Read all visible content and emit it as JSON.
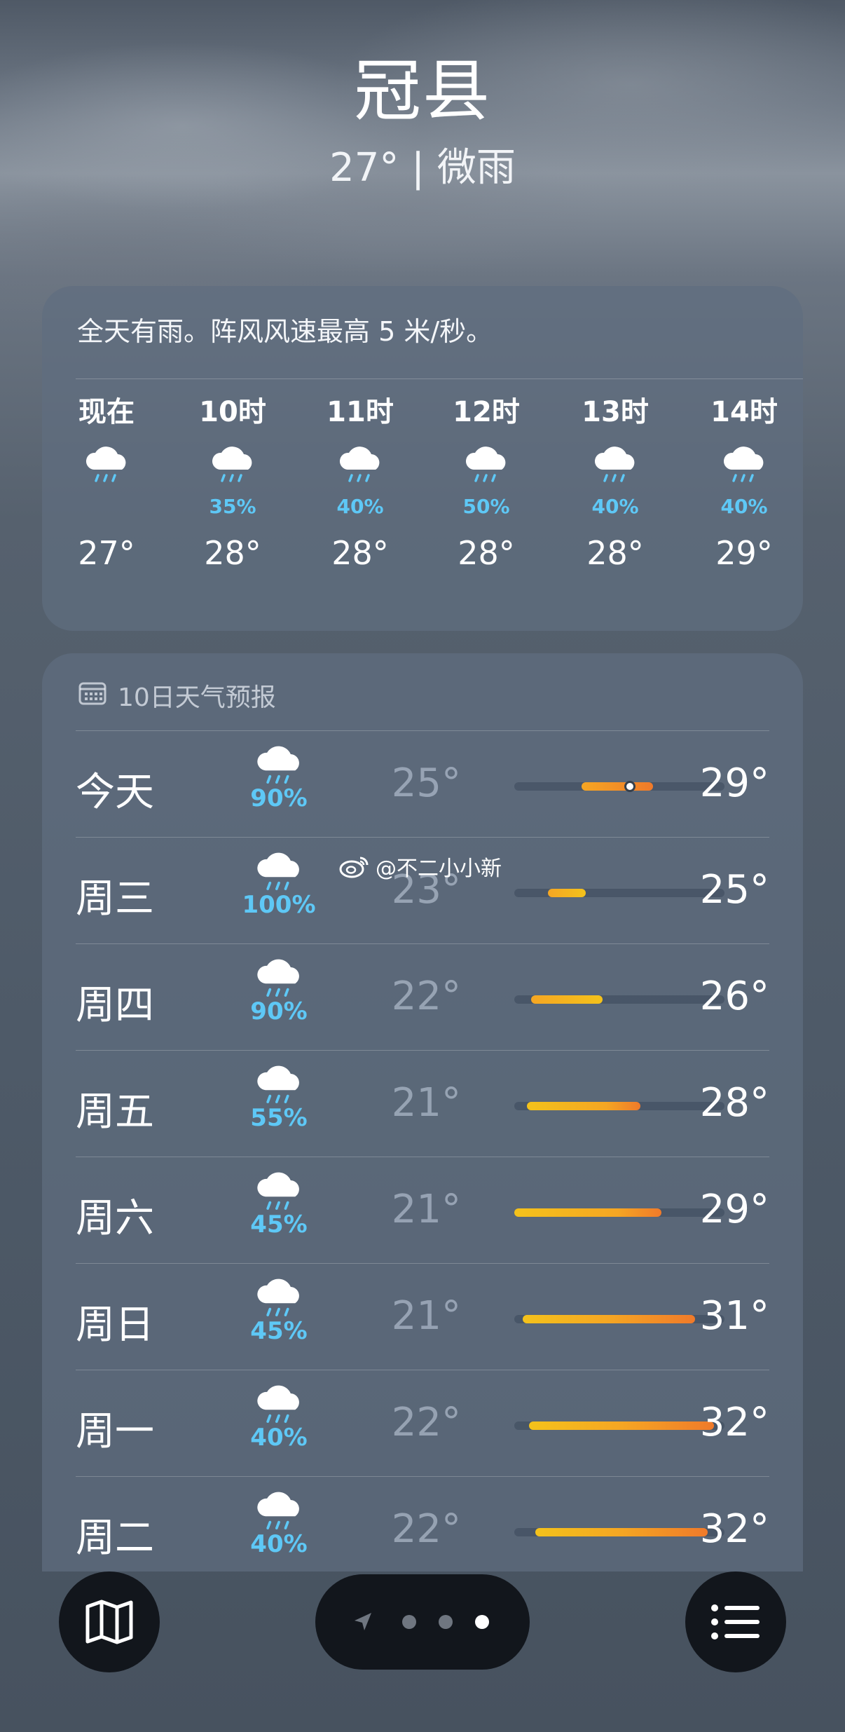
{
  "header": {
    "city": "冠县",
    "summary": "27° | 微雨"
  },
  "hourly_card": {
    "text": "全天有雨。阵风风速最高 5 米/秒。",
    "hours": [
      {
        "label": "现在",
        "icon": "rain-cloud-icon",
        "pop": "",
        "temp": "27°"
      },
      {
        "label": "10时",
        "icon": "rain-cloud-icon",
        "pop": "35%",
        "temp": "28°"
      },
      {
        "label": "11时",
        "icon": "rain-cloud-icon",
        "pop": "40%",
        "temp": "28°"
      },
      {
        "label": "12时",
        "icon": "rain-cloud-icon",
        "pop": "50%",
        "temp": "28°"
      },
      {
        "label": "13时",
        "icon": "rain-cloud-icon",
        "pop": "40%",
        "temp": "28°"
      },
      {
        "label": "14时",
        "icon": "rain-cloud-icon",
        "pop": "40%",
        "temp": "29°"
      }
    ]
  },
  "forecast": {
    "title": "10日天气预报",
    "title_icon": "calendar-icon",
    "range_fraction": [
      {
        "start": 0.32,
        "end": 0.66
      },
      {
        "start": 0.16,
        "end": 0.34
      },
      {
        "start": 0.08,
        "end": 0.42
      },
      {
        "start": 0.06,
        "end": 0.6
      },
      {
        "start": 0.0,
        "end": 0.7
      },
      {
        "start": 0.04,
        "end": 0.86
      },
      {
        "start": 0.07,
        "end": 0.95
      },
      {
        "start": 0.1,
        "end": 0.92
      }
    ],
    "days": [
      {
        "day": "今天",
        "pop": "90%",
        "low": "25°",
        "high": "29°",
        "current": true,
        "current_fraction": 0.55
      },
      {
        "day": "周三",
        "pop": "100%",
        "low": "23°",
        "high": "25°"
      },
      {
        "day": "周四",
        "pop": "90%",
        "low": "22°",
        "high": "26°"
      },
      {
        "day": "周五",
        "pop": "55%",
        "low": "21°",
        "high": "28°"
      },
      {
        "day": "周六",
        "pop": "45%",
        "low": "21°",
        "high": "29°"
      },
      {
        "day": "周日",
        "pop": "45%",
        "low": "21°",
        "high": "31°"
      },
      {
        "day": "周一",
        "pop": "40%",
        "low": "22°",
        "high": "32°"
      },
      {
        "day": "周二",
        "pop": "40%",
        "low": "22°",
        "high": "32°"
      }
    ]
  },
  "watermark": {
    "text": "@不二小小新",
    "icon": "weibo-icon"
  },
  "toolbar": {
    "map_icon": "map-icon",
    "list_icon": "list-icon",
    "pages": [
      "location-arrow-icon",
      "dot",
      "dot",
      "dot-active"
    ]
  },
  "colors": {
    "precip": "#5ec8f6",
    "bar_warm": "#f5a623",
    "bar_hot": "#f07a2a",
    "bar_yellow": "#f4c21b"
  }
}
